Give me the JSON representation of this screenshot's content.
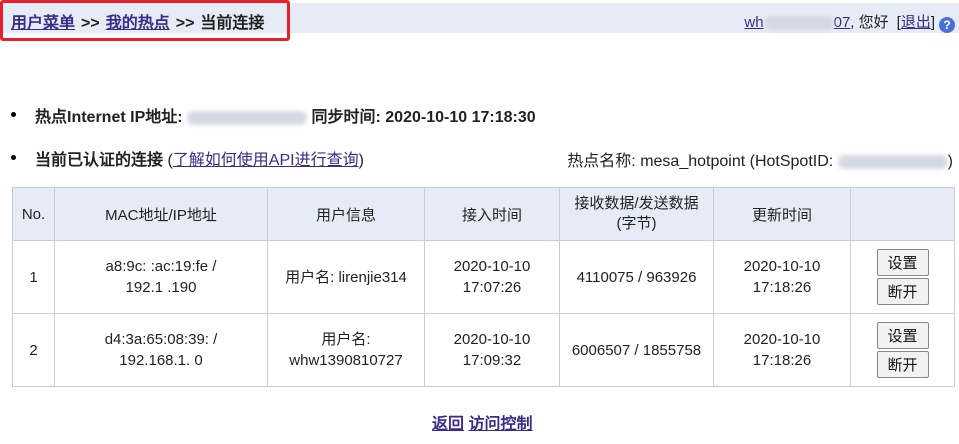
{
  "breadcrumb": {
    "item1": "用户菜单",
    "sep1": ">>",
    "item2": "我的热点",
    "sep2": ">>",
    "current": "当前连接"
  },
  "user": {
    "username_partial": "wh",
    "username_tail": "07",
    "greeting": ", 您好",
    "logout_open": "[",
    "logout": "退出",
    "logout_close": "]"
  },
  "info": {
    "ip_label": "热点Internet IP地址:",
    "sync_label": "同步时间:",
    "sync_time": "2020-10-10 17:18:30",
    "auth_label": "当前已认证的连接",
    "api_link": "了解如何使用API进行查询",
    "hotspot_name_label": "热点名称:",
    "hotspot_name": "mesa_hotpoint",
    "hotspot_id_label": "(HotSpotID:",
    "hotspot_id_close": ")"
  },
  "table": {
    "headers": [
      "No.",
      "MAC地址/IP地址",
      "用户信息",
      "接入时间",
      "接收数据/发送数据\n(字节)",
      "更新时间",
      ""
    ],
    "rows": [
      {
        "no": "1",
        "mac": "a8:9c:  :ac:19:fe /",
        "ip": "192.1     .190",
        "user": "用户名: lirenjie314",
        "access_date": "2020-10-10",
        "access_time": "17:07:26",
        "data": "4110075 / 963926",
        "update_date": "2020-10-10",
        "update_time": "17:18:26",
        "btn_settings": "设置",
        "btn_disconnect": "断开"
      },
      {
        "no": "2",
        "mac": "d4:3a:65:08:39:   /",
        "ip": "192.168.1.  0",
        "user_label": "用户名:",
        "user_name": "whw1390810727",
        "access_date": "2020-10-10",
        "access_time": "17:09:32",
        "data": "6006507 / 1855758",
        "update_date": "2020-10-10",
        "update_time": "17:18:26",
        "btn_settings": "设置",
        "btn_disconnect": "断开"
      }
    ]
  },
  "footer": {
    "back": "返回",
    "access_control": "访问控制"
  },
  "colors": {
    "header_bg": "#e6ecf6",
    "link": "#3a2a8c",
    "highlight_border": "#e8202a"
  },
  "icons": {
    "help": "help-circle-icon"
  }
}
